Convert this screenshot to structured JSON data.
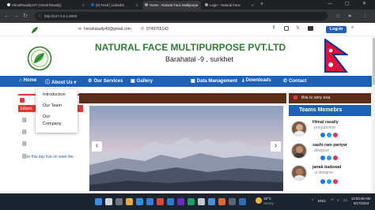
{
  "browser": {
    "tabs": [
      {
        "label": "HimalRasaily127 (Himal Rasaily)",
        "active": false
      },
      {
        "label": "(5) Feed | LinkedIn",
        "active": false
      },
      {
        "label": "Home - Natural Face Multipurpo",
        "active": true
      },
      {
        "label": "Login - Natural Face",
        "active": false
      }
    ],
    "url": "http://127.0.0.1:8000"
  },
  "contact": {
    "email": "himalrasaily49@gmail.com",
    "phone": "9749755143",
    "login_label": "Log-in"
  },
  "header": {
    "title": "NATURAL FACE MULTIPURPOSE PVT.LTD",
    "address": "Barahatal -9 , surkhet"
  },
  "nav": {
    "items": [
      {
        "label": "Home"
      },
      {
        "label": "About Us"
      },
      {
        "label": "Our Services"
      },
      {
        "label": "Gallery"
      },
      {
        "label": "Data Management"
      },
      {
        "label": "Downloads"
      },
      {
        "label": "Contact"
      }
    ]
  },
  "about_menu": {
    "items": [
      "Introduction",
      "Our Team",
      "Our",
      "Company"
    ]
  },
  "info": {
    "heading_fragment": "Inform",
    "news_fragment": "to this day live on work the"
  },
  "ticker": {
    "text": "this is very exa"
  },
  "carousel": {
    "prev": "‹",
    "next": "›"
  },
  "team": {
    "heading": "Teams Memebrs",
    "members": [
      {
        "name": "Himal rasaily",
        "role": "programmer"
      },
      {
        "name": "sashi ram pariyar",
        "role": "designer"
      },
      {
        "name": "janak baduwal",
        "role": "ui designer"
      }
    ]
  },
  "taskbar": {
    "weather_temp": "19°C",
    "weather_desc": "Sunny",
    "lang": "ENG",
    "time": "12:53:48 AM",
    "date": "8/17/2023"
  },
  "colors": {
    "brand_blue": "#1f61b7",
    "title_green": "#2e7d32",
    "brown_bar": "#5a2e1a",
    "login_button": "#1f61b7",
    "ticker_red": "#e53935"
  }
}
